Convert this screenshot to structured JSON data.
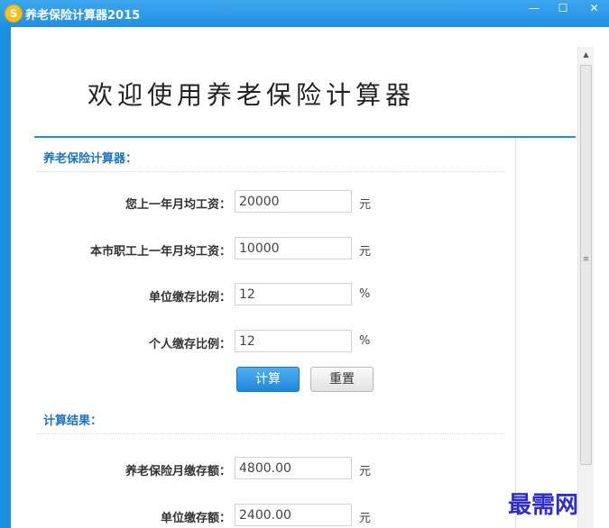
{
  "window": {
    "title": "养老保险计算器2015",
    "logo": "S",
    "minimize": "—",
    "maximize": "☐",
    "close": "✕"
  },
  "welcome_text": "欢迎使用养老保险计算器",
  "calculator": {
    "section_title": "养老保险计算器：",
    "fields": [
      {
        "label": "您上一年月均工资：",
        "value": "20000",
        "unit": "元"
      },
      {
        "label": "本市职工上一年月均工资：",
        "value": "10000",
        "unit": "元"
      },
      {
        "label": "单位缴存比例：",
        "value": "12",
        "unit": "%"
      },
      {
        "label": "个人缴存比例：",
        "value": "12",
        "unit": "%"
      }
    ],
    "calc_button": "计算",
    "reset_button": "重置"
  },
  "results": {
    "section_title": "计算结果：",
    "fields": [
      {
        "label": "养老保险月缴存额：",
        "value": "4800.00",
        "unit": "元"
      },
      {
        "label": "单位缴存额：",
        "value": "2400.00",
        "unit": "元"
      }
    ]
  },
  "scrollbar": {
    "up_arrow": "▲",
    "grip": "≡"
  },
  "watermark": "最需网",
  "colors": {
    "accent": "#1f8fe4",
    "section_title": "#1a73c7",
    "watermark": "#2c2cd4"
  },
  "icons": {
    "logo": "app-logo-icon",
    "minimize": "minimize-icon",
    "maximize": "maximize-icon",
    "close": "close-icon"
  }
}
